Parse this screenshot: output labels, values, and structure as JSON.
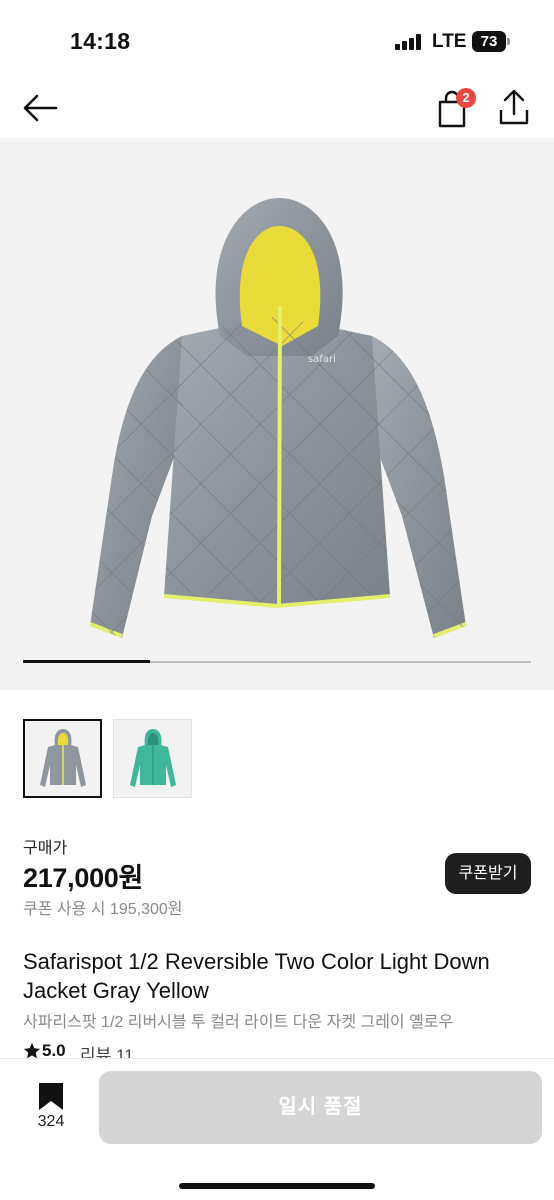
{
  "status_bar": {
    "time": "14:18",
    "network": "LTE",
    "battery": "73"
  },
  "nav": {
    "back_icon": "arrow-left-icon",
    "cart_icon": "shopping-bag-icon",
    "cart_badge": "2",
    "share_icon": "share-icon"
  },
  "gallery": {
    "image_count": 2,
    "current_index": 1,
    "progress_fraction": 0.25,
    "images": [
      {
        "color_body": "#8f969e",
        "color_lining": "#e9dc3a",
        "color_trim": "#e4ef6b"
      },
      {
        "color_body": "#3fb79a",
        "color_lining": "#2f8f7a",
        "color_trim": "#2e9a80"
      }
    ]
  },
  "price": {
    "label": "구매가",
    "value": "217,000원",
    "coupon_text": "쿠폰 사용 시 195,300원",
    "coupon_button": "쿠폰받기"
  },
  "product": {
    "title_en": "Safarispot 1/2 Reversible Two Color Light Down Jacket Gray Yellow",
    "title_ko": "사파리스팟 1/2 리버시블 투 컬러 라이트 다운 자켓 그레이 옐로우",
    "rating": "5.0",
    "review_label": "리뷰 11"
  },
  "bottom_bar": {
    "bookmark_icon": "bookmark-icon",
    "bookmark_count": "324",
    "soldout_label": "일시 품절"
  }
}
